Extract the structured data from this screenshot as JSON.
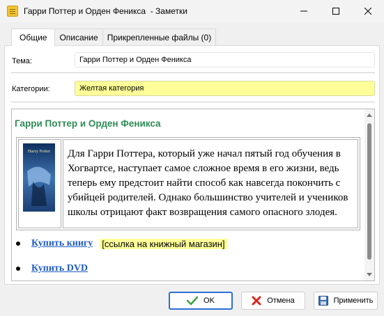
{
  "window": {
    "title": "Гарри Поттер и Орден Феникса  - Заметки",
    "buttons": {
      "minimize": "—",
      "maximize": "☐",
      "close": "✕"
    }
  },
  "tabs": [
    {
      "label": "Общие",
      "active": true
    },
    {
      "label": "Описание",
      "active": false
    },
    {
      "label": "Прикрепленные файлы (0)",
      "active": false
    }
  ],
  "form": {
    "topic_label": "Тема:",
    "topic_value": "Гарри Поттер и Орден Феникса",
    "category_label": "Категории:",
    "category_value": "Желтая категория"
  },
  "note": {
    "heading": "Гарри Поттер и Орден Феникса",
    "cover_title": "Harry Potter",
    "description": "Для Гарри Поттера, который уже начал пятый год обучения в Хогвартсе, наступает самое сложное время в его жизни, ведь теперь ему предстоит найти способ как навсегда покончить с убийцей родителей. Однако большинство учителей и учеников школы отрицают факт возвращения самого опасного злодея.",
    "links": [
      {
        "text": "Купить книгу",
        "note": "[ссылка на книжный магазин]"
      },
      {
        "text": "Купить DVD",
        "note": ""
      }
    ]
  },
  "footer": {
    "ok": "OK",
    "cancel": "Отмена",
    "apply": "Применить"
  },
  "colors": {
    "heading": "#2e8b57",
    "link": "#1f5cc6",
    "highlight": "#ffff99",
    "default_button_border": "#2a6fd6"
  }
}
